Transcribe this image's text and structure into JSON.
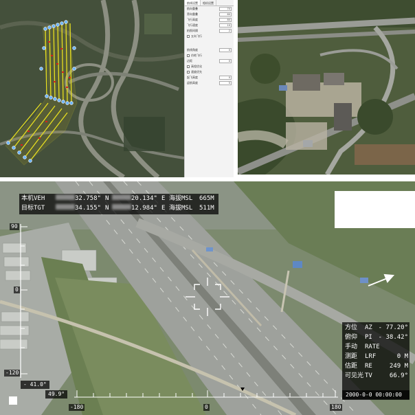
{
  "plan_panel": {
    "tabs": [
      "航线设置",
      "相机设置"
    ],
    "rows": [
      {
        "label": "航向重叠",
        "value": "70"
      },
      {
        "label": "旁向重叠",
        "value": "60"
      },
      {
        "label": "飞行高度",
        "value": "80"
      },
      {
        "label": "飞行速度",
        "value": "10"
      },
      {
        "label": "拍照间隔",
        "value": "2"
      },
      {
        "label": "航线角度",
        "value": "0"
      },
      {
        "label": "边距",
        "value": "0"
      },
      {
        "label": "起飞高度",
        "value": "0"
      },
      {
        "label": "返航高度",
        "value": "5"
      }
    ],
    "checks": [
      "五向飞行",
      "仿地飞行",
      "高程优化",
      "速度优先"
    ]
  },
  "video": {
    "coords": {
      "row1": {
        "label": "本机VEH",
        "lat": "32.758\"",
        "lat_dir": "N",
        "lon": "20.134\"",
        "lon_dir": "E",
        "alt_label": "海拔MSL",
        "alt": "665M"
      },
      "row2": {
        "label": "目标TGT",
        "lat": "34.155\"",
        "lat_dir": "N",
        "lon": "12.984\"",
        "lon_dir": "E",
        "alt_label": "海拔MSL",
        "alt": "511M"
      }
    },
    "pitch_labels": {
      "top": "90",
      "mid": "0",
      "bottom": "-120"
    },
    "angle_readout_1": "- 41.0°",
    "angle_readout_2": "49.9°",
    "heading_labels": {
      "left": "-180",
      "center": "0",
      "right": "180"
    },
    "status": [
      {
        "cn": "方位",
        "abbr": "AZ",
        "value": "- 77.20°"
      },
      {
        "cn": "俯仰",
        "abbr": "PI",
        "value": "- 38.42°"
      },
      {
        "cn": "手动",
        "abbr": "RATE",
        "value": ""
      },
      {
        "cn": "测距",
        "abbr": "LRF",
        "value": "0 M"
      },
      {
        "cn": "估距",
        "abbr": "RE",
        "value": "249 M"
      },
      {
        "cn": "可见光",
        "abbr": "TV",
        "value": "66.9°"
      }
    ],
    "datetime": "2000-0-0   00:00:00"
  },
  "colors": {
    "hud_bg": "#000000",
    "hud_text": "#ffffff",
    "flight_line": "#e8e020",
    "waypoint": "#6fb6ff",
    "marker": "#d8201a"
  }
}
